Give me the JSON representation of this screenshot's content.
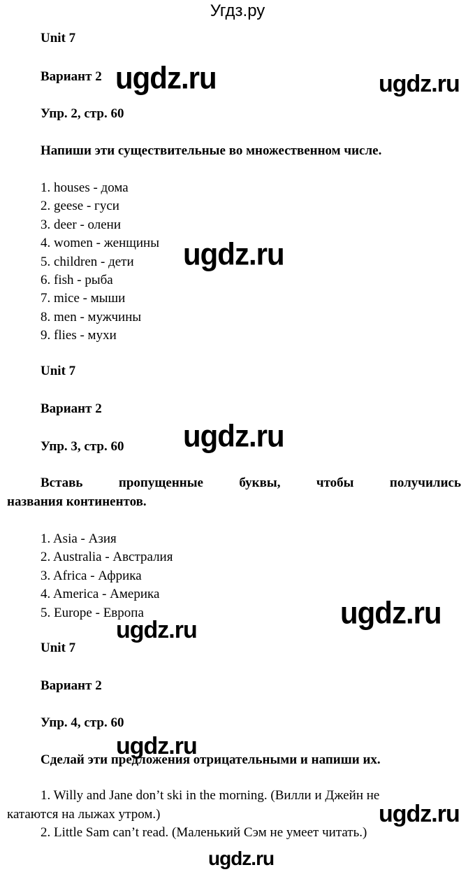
{
  "site_title": "Угдз.ру",
  "watermark": "ugdz.ru",
  "sections": [
    {
      "unit": "Unit 7",
      "variant": "Вариант 2",
      "exercise": "Упр. 2, стр. 60",
      "task": "Напиши эти существительные во множественном числе.",
      "items": [
        "1. houses - дома",
        "2. geese - гуси",
        "3. deer - олени",
        "4. women - женщины",
        "5. children - дети",
        "6. fish - рыба",
        "7. mice - мыши",
        "8. men - мужчины",
        "9. flies - мухи"
      ]
    },
    {
      "unit": "Unit 7",
      "variant": "Вариант 2",
      "exercise": "Упр. 3, стр. 60",
      "task_line1": "Вставь пропущенные буквы, чтобы получились",
      "task_line2": "названия континентов.",
      "items": [
        "1. Asia - Азия",
        "2. Australia - Австралия",
        "3. Africa - Африка",
        "4. America - Америка",
        "5. Europe - Европа"
      ]
    },
    {
      "unit": "Unit 7",
      "variant": "Вариант 2",
      "exercise": "Упр. 4, стр. 60",
      "task": "Сделай эти предложения отрицательными и напиши их.",
      "items": [
        {
          "line1": "1. Willy and Jane don’t ski in the morning. (Вилли и Джейн не",
          "line2": "катаются на лыжах утром.)"
        },
        {
          "line1": "2. Little Sam can’t read. (Маленький Сэм не умеет читать.)"
        }
      ]
    }
  ]
}
